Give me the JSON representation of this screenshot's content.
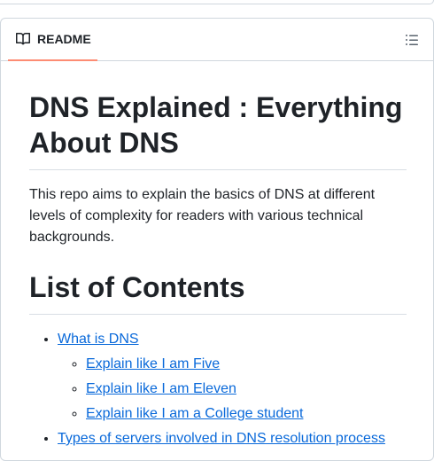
{
  "readme": {
    "tab_label": "README",
    "outline_icon": "list-unordered-icon",
    "book_icon": "book-icon"
  },
  "article": {
    "title": "DNS Explained : Everything About DNS",
    "intro": "This repo aims to explain the basics of DNS at different levels of complexity for readers with various technical backgrounds.",
    "contents_heading": "List of Contents",
    "toc": {
      "what_is_dns": "What is DNS",
      "sub": [
        "Explain like I am Five",
        "Explain like I am Eleven",
        "Explain like I am a College student"
      ],
      "types_of_servers": "Types of servers involved in DNS resolution process"
    }
  },
  "colors": {
    "tab_underline": "#fd8c73",
    "link": "#0969da",
    "border": "#d0d7de"
  }
}
